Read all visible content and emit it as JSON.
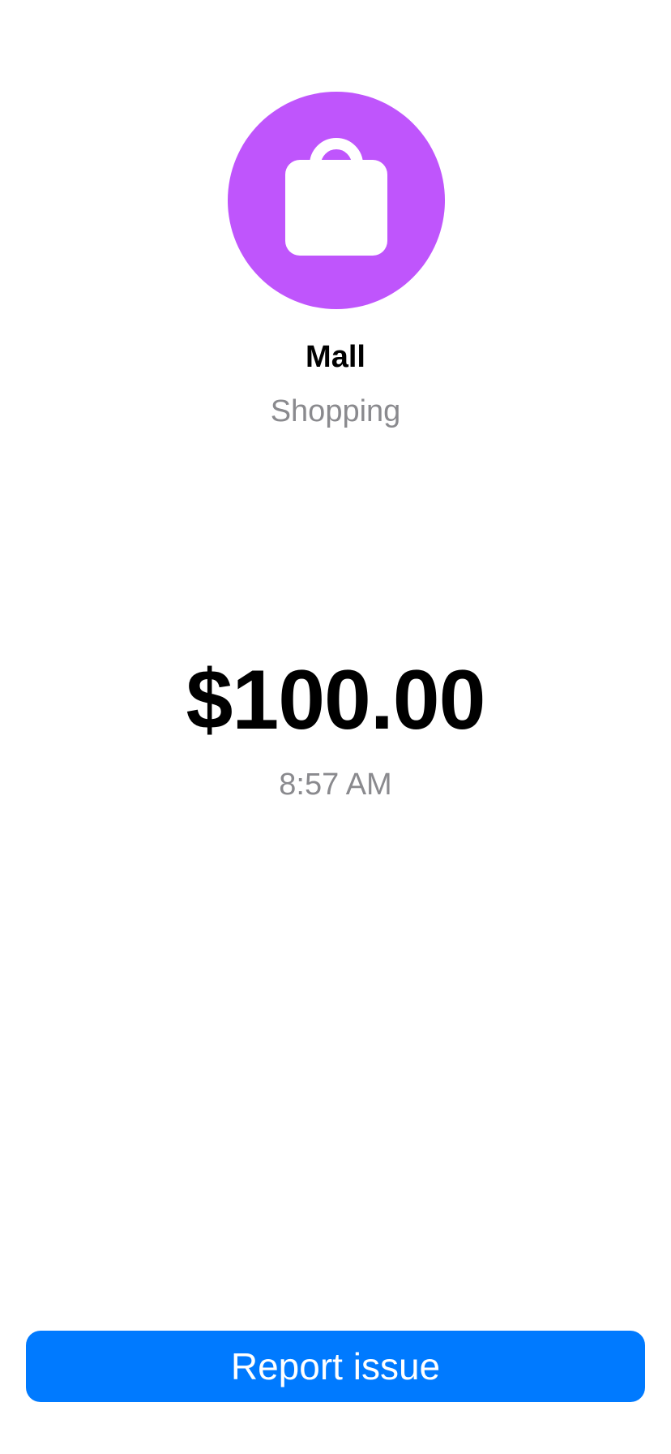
{
  "merchant": {
    "icon": "shopping-bag-icon",
    "icon_bg_color": "#BF55FC",
    "name": "Mall",
    "category": "Shopping"
  },
  "transaction": {
    "amount": "$100.00",
    "time": "8:57 AM"
  },
  "actions": {
    "report_label": "Report issue",
    "report_color": "#007AFF"
  }
}
